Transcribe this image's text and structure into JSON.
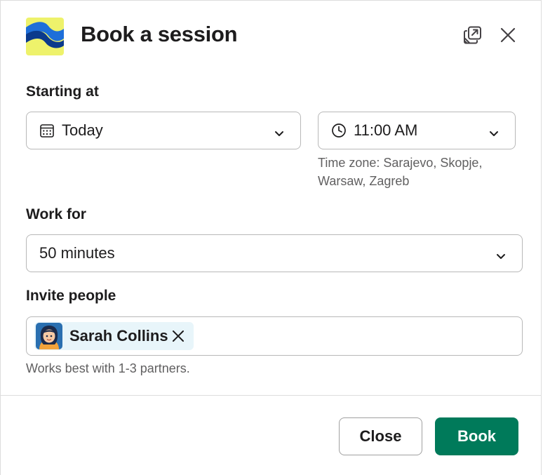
{
  "header": {
    "title": "Book a session",
    "logo_icon": "app-logo-icon",
    "popout_icon": "popout-icon",
    "close_icon": "close-icon"
  },
  "starting_at": {
    "label": "Starting at",
    "date_value": "Today",
    "date_icon": "calendar-icon",
    "time_value": "11:00 AM",
    "time_icon": "clock-icon",
    "timezone_line1": "Time zone: Sarajevo, Skopje,",
    "timezone_line2": "Warsaw, Zagreb"
  },
  "work_for": {
    "label": "Work for",
    "value": "50 minutes"
  },
  "invite": {
    "label": "Invite people",
    "people": [
      {
        "name": "Sarah Collins"
      }
    ],
    "hint": "Works best with 1-3 partners."
  },
  "footer": {
    "close_label": "Close",
    "book_label": "Book"
  },
  "colors": {
    "primary": "#007a5a",
    "chip_bg": "#e8f5fa",
    "border": "#b8b8b8",
    "hint_text": "#616061"
  }
}
